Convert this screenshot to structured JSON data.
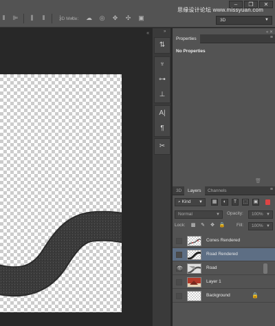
{
  "window": {
    "controls": [
      "–",
      "❐",
      "✕"
    ]
  },
  "watermark": "思缘设计论坛 www.missyuan.com",
  "options_bar": {
    "mode_label": "3D Mode:",
    "workspace": "3D"
  },
  "properties_panel": {
    "tab": "Properties",
    "message": "No Properties"
  },
  "layers_panel": {
    "tabs": [
      "3D",
      "Layers",
      "Channels"
    ],
    "active_tab": "Layers",
    "filter_kind": "Kind",
    "blend_mode": "Normal",
    "opacity_label": "Opacity:",
    "opacity_value": "100%",
    "lock_label": "Lock:",
    "fill_label": "Fill:",
    "fill_value": "100%",
    "layers": [
      {
        "name": "Cones Rendered",
        "visible": false,
        "selected": false,
        "thumb": "cones"
      },
      {
        "name": "Road Rendered",
        "visible": false,
        "selected": true,
        "thumb": "road"
      },
      {
        "name": "Road",
        "visible": true,
        "selected": false,
        "thumb": "road3d"
      },
      {
        "name": "Layer 1",
        "visible": false,
        "selected": false,
        "thumb": "photo"
      },
      {
        "name": "Background",
        "visible": false,
        "selected": false,
        "thumb": "blank",
        "locked": true
      }
    ]
  },
  "colors": {
    "selected_layer": "#5d6e84",
    "panel_bg": "#535353",
    "canvas_bg": "#282828"
  }
}
